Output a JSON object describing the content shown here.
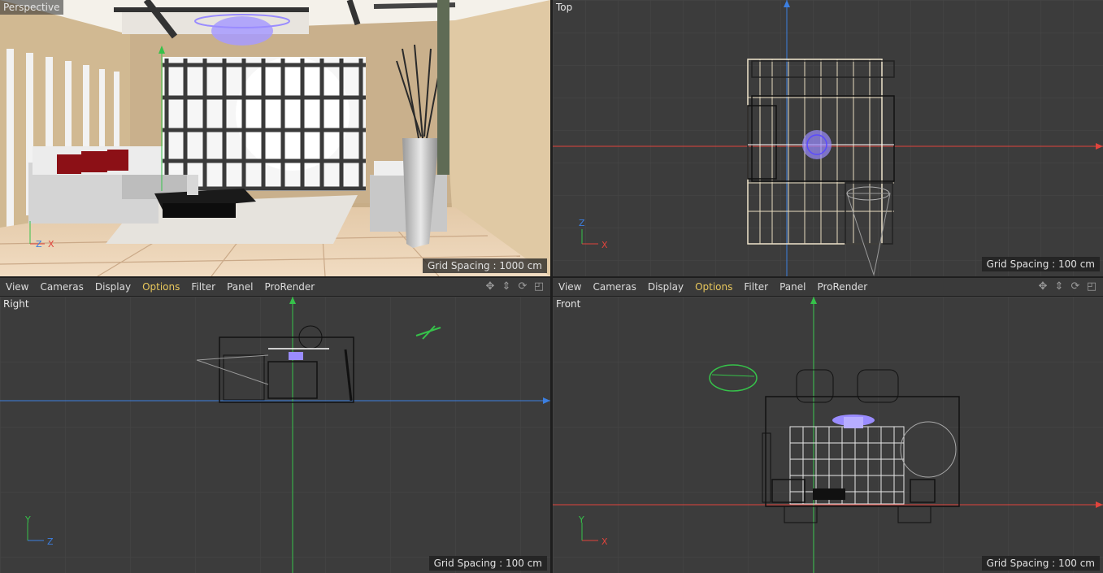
{
  "menus": [
    "View",
    "Cameras",
    "Display",
    "Options",
    "Filter",
    "Panel",
    "ProRender"
  ],
  "active_menu": "Options",
  "viewports": {
    "perspective": {
      "label": "Perspective",
      "grid_spacing": "Grid Spacing : 1000 cm"
    },
    "top": {
      "label": "Top",
      "grid_spacing": "Grid Spacing : 100 cm"
    },
    "right": {
      "label": "Right",
      "grid_spacing": "Grid Spacing : 100 cm"
    },
    "front": {
      "label": "Front",
      "grid_spacing": "Grid Spacing : 100 cm"
    }
  },
  "axis": {
    "x": "X",
    "y": "Y",
    "z": "Z"
  },
  "colors": {
    "x_axis": "#e0443c",
    "y_axis": "#36c24a",
    "z_axis": "#3c7fe0",
    "viewport_bg": "#3c3c3c",
    "grid": "#4a4a4a",
    "selection": "#9a8cff"
  }
}
